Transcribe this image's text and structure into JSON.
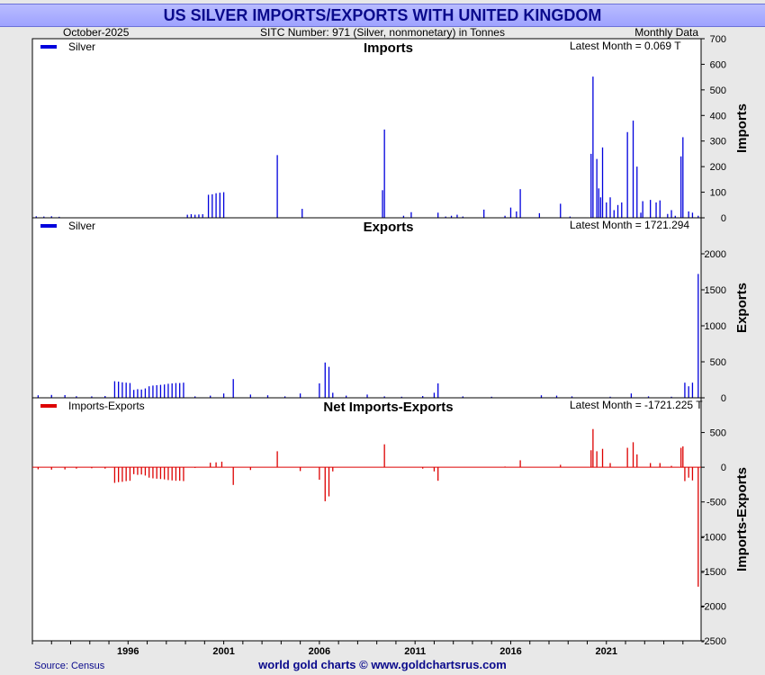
{
  "title": "US SILVER IMPORTS/EXPORTS WITH UNITED KINGDOM",
  "header": {
    "date": "October-2025",
    "sitc": "SITC Number: 971 (Silver, nonmonetary) in Tonnes",
    "frequency": "Monthly Data"
  },
  "footer": {
    "source": "Source: Census",
    "credit": "world gold charts © www.goldchartsrus.com"
  },
  "colors": {
    "blue": "#0000dd",
    "red": "#dd0000",
    "title": "#0a0a8c"
  },
  "chart_data": [
    {
      "type": "bar",
      "title": "Imports",
      "ylabel": "Imports",
      "legend": "Silver",
      "latest": "Latest Month = 0.069 T",
      "ylim": [
        0,
        700
      ],
      "yticks": [
        0,
        100,
        200,
        300,
        400,
        500,
        600,
        700
      ],
      "color": "#0000dd",
      "x": [
        1991.2,
        1991.6,
        1992.0,
        1992.4,
        1999.1,
        1999.3,
        1999.5,
        1999.7,
        1999.9,
        2000.2,
        2000.4,
        2000.6,
        2000.8,
        2001.0,
        2003.8,
        2005.1,
        2009.3,
        2009.4,
        2010.4,
        2010.8,
        2012.2,
        2012.6,
        2012.9,
        2013.2,
        2013.5,
        2014.6,
        2015.7,
        2016.0,
        2016.3,
        2016.5,
        2017.5,
        2018.6,
        2019.1,
        2020.2,
        2020.3,
        2020.5,
        2020.6,
        2020.7,
        2020.8,
        2021.0,
        2021.2,
        2021.4,
        2021.6,
        2021.8,
        2022.1,
        2022.4,
        2022.6,
        2022.8,
        2022.9,
        2023.3,
        2023.6,
        2023.8,
        2024.2,
        2024.4,
        2024.6,
        2024.9,
        2025.0,
        2025.3,
        2025.5,
        2025.8
      ],
      "values": [
        6,
        5,
        6,
        4,
        12,
        14,
        12,
        13,
        14,
        90,
        92,
        96,
        98,
        100,
        245,
        35,
        108,
        345,
        8,
        22,
        20,
        5,
        8,
        12,
        5,
        32,
        8,
        40,
        25,
        112,
        18,
        55,
        5,
        250,
        552,
        230,
        115,
        80,
        275,
        60,
        80,
        30,
        50,
        60,
        335,
        380,
        200,
        20,
        65,
        70,
        60,
        68,
        15,
        30,
        8,
        240,
        315,
        25,
        20,
        8
      ]
    },
    {
      "type": "bar",
      "title": "Exports",
      "ylabel": "Exports",
      "legend": "Silver",
      "latest": "Latest Month = 1721.294",
      "ylim": [
        0,
        2500
      ],
      "yticks": [
        0,
        500,
        1000,
        1500,
        2000,
        2500
      ],
      "color": "#0000dd",
      "x": [
        1991.3,
        1992.0,
        1992.7,
        1993.3,
        1994.1,
        1994.8,
        1995.3,
        1995.5,
        1995.7,
        1995.9,
        1996.1,
        1996.3,
        1996.5,
        1996.7,
        1996.9,
        1997.1,
        1997.3,
        1997.5,
        1997.7,
        1997.9,
        1998.1,
        1998.3,
        1998.5,
        1998.7,
        1998.9,
        1999.5,
        2000.3,
        2001.0,
        2001.5,
        2002.4,
        2003.3,
        2004.2,
        2005.0,
        2006.0,
        2006.3,
        2006.5,
        2006.7,
        2007.4,
        2008.5,
        2009.4,
        2010.3,
        2011.4,
        2012.0,
        2012.2,
        2013.5,
        2015.0,
        2017.6,
        2018.4,
        2019.2,
        2021.2,
        2022.3,
        2023.2,
        2024.4,
        2025.1,
        2025.3,
        2025.5,
        2025.8
      ],
      "values": [
        35,
        40,
        38,
        22,
        20,
        25,
        230,
        225,
        215,
        210,
        205,
        110,
        120,
        115,
        130,
        160,
        170,
        175,
        180,
        185,
        195,
        200,
        205,
        205,
        210,
        20,
        30,
        60,
        260,
        45,
        35,
        20,
        60,
        200,
        490,
        430,
        70,
        30,
        45,
        20,
        15,
        25,
        70,
        200,
        20,
        15,
        35,
        30,
        20,
        15,
        60,
        20,
        15,
        210,
        160,
        210,
        1721
      ]
    },
    {
      "type": "bar",
      "title": "Net Imports-Exports",
      "ylabel": "Imports-Exports",
      "legend": "Imports-Exports",
      "latest": "Latest Month = -1721.225 T",
      "ylim": [
        -2500,
        1000
      ],
      "yticks": [
        -2500,
        -2000,
        -1500,
        -1000,
        -500,
        0,
        500,
        1000
      ],
      "color": "#dd0000",
      "x": [
        1991.3,
        1992.0,
        1992.7,
        1993.3,
        1994.1,
        1994.8,
        1995.3,
        1995.5,
        1995.7,
        1995.9,
        1996.1,
        1996.3,
        1996.5,
        1996.7,
        1996.9,
        1997.1,
        1997.3,
        1997.5,
        1997.7,
        1997.9,
        1998.1,
        1998.3,
        1998.5,
        1998.7,
        1998.9,
        1999.5,
        2000.3,
        2000.6,
        2000.9,
        2001.5,
        2002.4,
        2003.8,
        2005.0,
        2006.0,
        2006.3,
        2006.5,
        2006.7,
        2009.4,
        2011.4,
        2012.0,
        2012.2,
        2015.7,
        2016.5,
        2018.6,
        2020.2,
        2020.3,
        2020.5,
        2020.8,
        2021.2,
        2022.1,
        2022.4,
        2022.6,
        2023.3,
        2023.8,
        2024.4,
        2024.9,
        2025.0,
        2025.1,
        2025.3,
        2025.5,
        2025.8
      ],
      "values": [
        -30,
        -35,
        -32,
        -20,
        -15,
        -20,
        -225,
        -215,
        -210,
        -200,
        -195,
        -100,
        -110,
        -105,
        -120,
        -150,
        -160,
        -165,
        -170,
        -175,
        -185,
        -190,
        -195,
        -195,
        -200,
        -10,
        65,
        70,
        80,
        -255,
        -40,
        230,
        -55,
        -180,
        -490,
        -420,
        -60,
        330,
        -20,
        -60,
        -195,
        10,
        100,
        35,
        245,
        550,
        230,
        265,
        60,
        280,
        360,
        185,
        60,
        60,
        20,
        280,
        300,
        -200,
        -150,
        -190,
        -1721
      ]
    }
  ],
  "xaxis": {
    "range": [
      1991.0,
      2025.95
    ],
    "ticks": [
      1996,
      2001,
      2006,
      2011,
      2016,
      2021
    ],
    "labels": [
      "1996",
      "2001",
      "2006",
      "2011",
      "2016",
      "2021"
    ]
  }
}
